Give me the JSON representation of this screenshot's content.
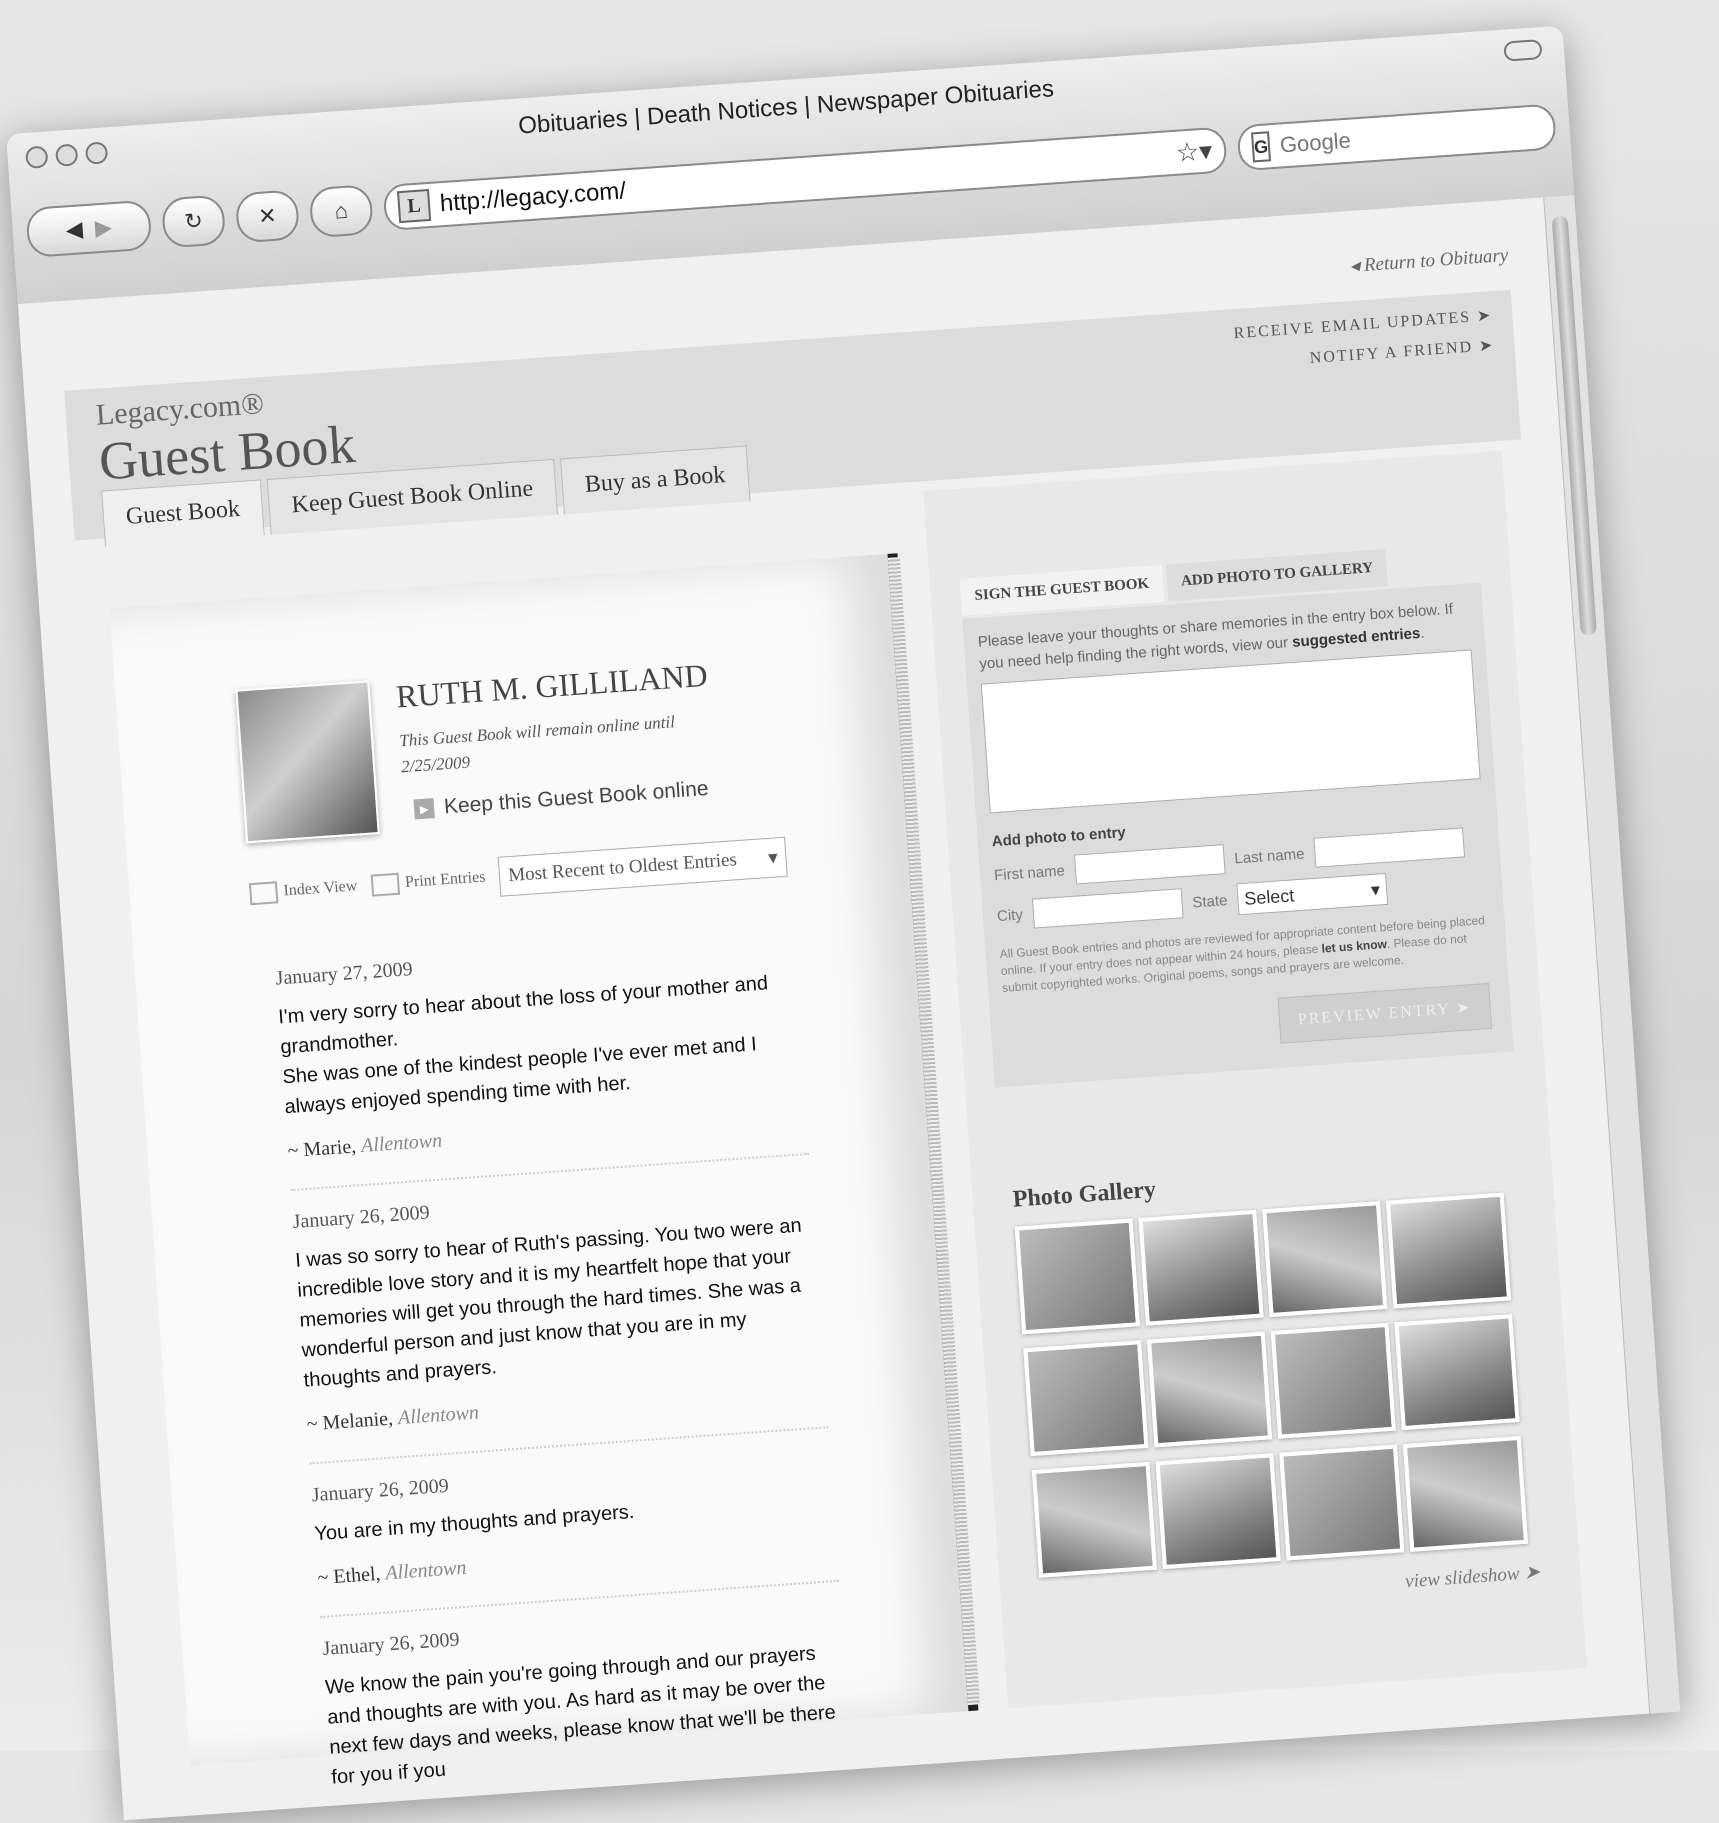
{
  "browser": {
    "title": "Obituaries | Death Notices | Newspaper Obituaries",
    "url": "http://legacy.com/",
    "url_favicon": "L",
    "search_placeholder": "Google",
    "search_engine_icon": "G",
    "nav_icons": [
      "back-icon",
      "forward-icon",
      "reload-icon",
      "stop-icon",
      "home-icon",
      "bookmark-star-icon",
      "search-icon"
    ]
  },
  "site": {
    "return_link": "◂ Return to Obituary",
    "brand_small": "Legacy.com®",
    "brand_big": "Guest Book",
    "header_links": [
      "RECEIVE EMAIL UPDATES ➤",
      "NOTIFY A FRIEND ➤"
    ],
    "tabs": [
      "Guest Book",
      "Keep Guest Book Online",
      "Buy as a Book"
    ]
  },
  "guestbook": {
    "name": "RUTH M. GILLILAND",
    "remain_text": "This Guest Book will remain online until 2/25/2009",
    "keep_online": "Keep this Guest Book online",
    "index_view": "Index View",
    "print_entries": "Print Entries",
    "sort_selected": "Most Recent to Oldest Entries",
    "entries": [
      {
        "date": "January 27, 2009",
        "text": "I'm very sorry to hear about the loss of your mother and grandmother.\nShe was one of the kindest people I've ever met and I always enjoyed spending time with her.",
        "author": "~ Marie,",
        "location": "Allentown"
      },
      {
        "date": "January 26, 2009",
        "text": "I was so sorry to hear of Ruth's passing. You two were an incredible love story and it is my heartfelt hope that your memories will get you through the hard times. She was a wonderful person and just know that you are in my thoughts and prayers.",
        "author": "~ Melanie,",
        "location": "Allentown"
      },
      {
        "date": "January 26, 2009",
        "text": "You are in my thoughts and prayers.",
        "author": "~ Ethel,",
        "location": "Allentown"
      },
      {
        "date": "January 26, 2009",
        "text": "We know the pain you're going through and our prayers and thoughts are with you. As hard as it may be over the next few days and weeks, please know that we'll be there for you if you",
        "author": "",
        "location": ""
      }
    ]
  },
  "form": {
    "tab_sign": "SIGN THE GUEST BOOK",
    "tab_photo": "ADD PHOTO TO GALLERY",
    "intro_1": "Please leave your thoughts or share memories in the entry box below. If you need help finding the right words, view our",
    "intro_link": "suggested entries",
    "intro_end": ".",
    "add_photo": "Add photo to entry",
    "first_name": "First name",
    "last_name": "Last name",
    "city": "City",
    "state": "State",
    "state_selected": "Select",
    "policy_1": "All Guest Book entries and photos are reviewed for appropriate content before being placed online. If your entry does not appear within 24 hours, please",
    "policy_link": "let us know",
    "policy_2": ". Please do not submit copyrighted works. Original poems, songs and prayers are welcome.",
    "preview": "PREVIEW ENTRY ➤"
  },
  "gallery": {
    "title": "Photo Gallery",
    "slideshow": "view slideshow ➤",
    "photos": 12
  }
}
